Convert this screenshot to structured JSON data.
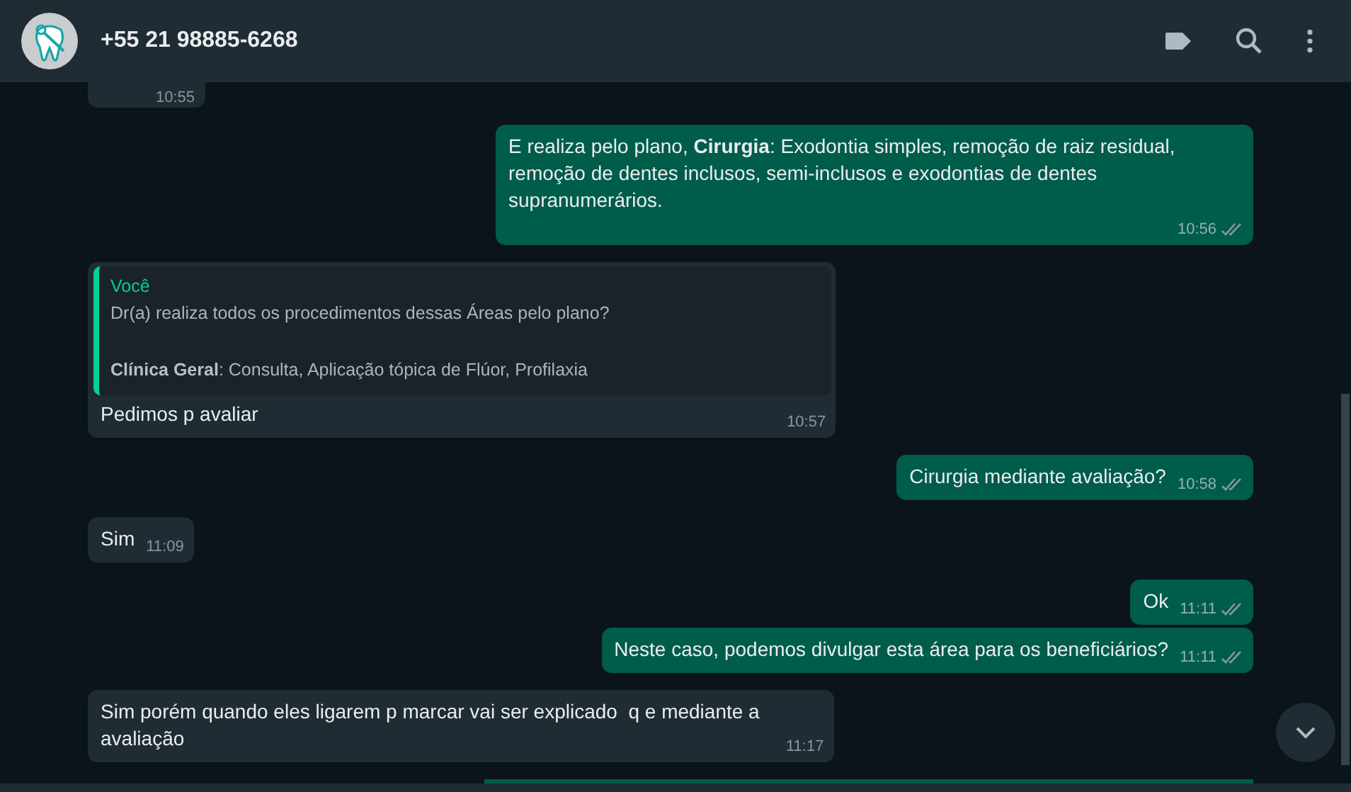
{
  "header": {
    "title": "+55 21 98885-6268"
  },
  "messages": [
    {
      "kind": "in",
      "time": "10:55",
      "clipped": true
    },
    {
      "kind": "out",
      "text": "E realiza pelo plano, **Cirurgia**: Exodontia simples, remoção de raiz residual, remoção de dentes inclusos, semi-inclusos e exodontias de dentes supranumerários.",
      "time": "10:56",
      "read": false
    },
    {
      "kind": "in",
      "quote": {
        "author": "Você",
        "paragraphs": [
          "Dr(a) realiza todos os procedimentos dessas Áreas pelo plano?",
          "**Clínica Geral**: Consulta, Aplicação tópica de Flúor, Profilaxia"
        ]
      },
      "text": "Pedimos p avaliar",
      "time": "10:57"
    },
    {
      "kind": "out",
      "text": "Cirurgia mediante avaliação?",
      "time": "10:58",
      "read": false
    },
    {
      "kind": "in",
      "text": "Sim",
      "time": "11:09"
    },
    {
      "kind": "out",
      "text": "Ok",
      "time": "11:11",
      "read": false
    },
    {
      "kind": "out",
      "text": "Neste caso, podemos divulgar esta área para os beneficiários?",
      "time": "11:11",
      "read": false
    },
    {
      "kind": "in",
      "text": "Sim porém quando eles ligarem p marcar vai ser explicado  q e mediante a avaliação",
      "time": "11:17"
    },
    {
      "kind": "out",
      "clipped": true
    }
  ]
}
